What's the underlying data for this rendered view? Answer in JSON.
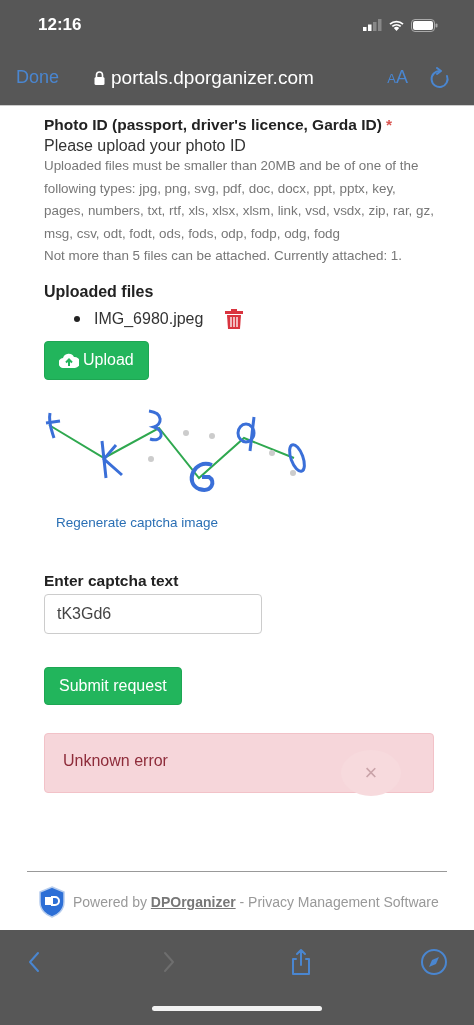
{
  "status_bar": {
    "time": "12:16"
  },
  "browser": {
    "done": "Done",
    "url": "portals.dporganizer.com",
    "text_size": [
      "A",
      "A"
    ]
  },
  "form": {
    "field_label": "Photo ID (passport, driver's licence, Garda ID)",
    "required_mark": "*",
    "prompt": "Please upload your photo ID",
    "help": [
      "Uploaded files must be smaller than 20MB and be of one of the following types: jpg, png, svg, pdf, doc, docx, ppt, pptx, key, pages, numbers, txt, rtf, xls, xlsx, xlsm, link, vsd, vsdx, zip, rar, gz, msg, csv, odt, fodt, ods, fods, odp, fodp, odg, fodg",
      "Not more than 5 files can be attached. Currently attached: 1."
    ],
    "uploaded_heading": "Uploaded files",
    "files": [
      {
        "name": "IMG_6980.jpeg"
      }
    ],
    "upload_button": "Upload",
    "regenerate_link": "Regenerate captcha image",
    "captcha_label": "Enter captcha text",
    "captcha_value": "tK3Gd6",
    "submit_button": "Submit request",
    "alert": {
      "message": "Unknown error",
      "close": "×"
    }
  },
  "footer": {
    "prefix": "Powered by",
    "link": "DPOrganizer",
    "suffix": "- Privacy Management Software"
  },
  "toolbar": [
    {
      "kind": "back",
      "disabled": false
    },
    {
      "kind": "forward",
      "disabled": true
    },
    {
      "kind": "share",
      "disabled": false
    },
    {
      "kind": "compass",
      "disabled": false
    }
  ]
}
